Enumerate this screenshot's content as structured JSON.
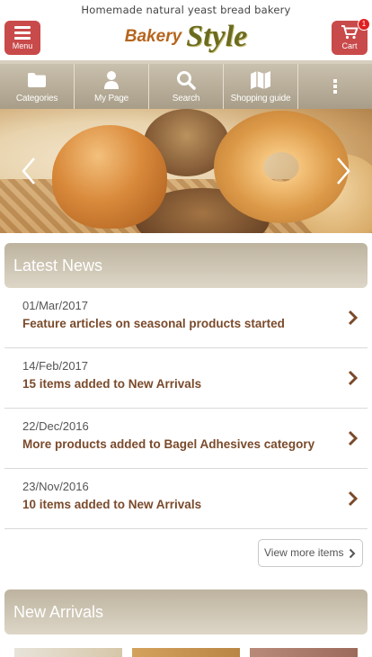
{
  "header": {
    "tagline": "Homemade natural yeast bread bakery",
    "logo_word1": "Bakery",
    "logo_word2": "Style",
    "menu_label": "Menu",
    "cart_label": "Cart",
    "cart_count": "1",
    "accent_color": "#c94a4a"
  },
  "nav": {
    "items": [
      {
        "label": "Categories",
        "icon": "folder-icon"
      },
      {
        "label": "My Page",
        "icon": "user-icon"
      },
      {
        "label": "Search",
        "icon": "search-icon"
      },
      {
        "label": "Shopping guide",
        "icon": "map-icon"
      },
      {
        "label": "",
        "icon": "more-vertical-icon"
      }
    ]
  },
  "hero": {
    "prev_icon": "chevron-left-icon",
    "next_icon": "chevron-right-icon"
  },
  "news": {
    "title": "Latest News",
    "items": [
      {
        "date": "01/Mar/2017",
        "title": "Feature articles on seasonal products started"
      },
      {
        "date": "14/Feb/2017",
        "title": "15 items added to New Arrivals"
      },
      {
        "date": "22/Dec/2016",
        "title": "More products added to Bagel Adhesives category"
      },
      {
        "date": "23/Nov/2016",
        "title": "10 items added to New Arrivals"
      }
    ],
    "more_label": "View more items"
  },
  "arrivals": {
    "title": "New Arrivals"
  }
}
